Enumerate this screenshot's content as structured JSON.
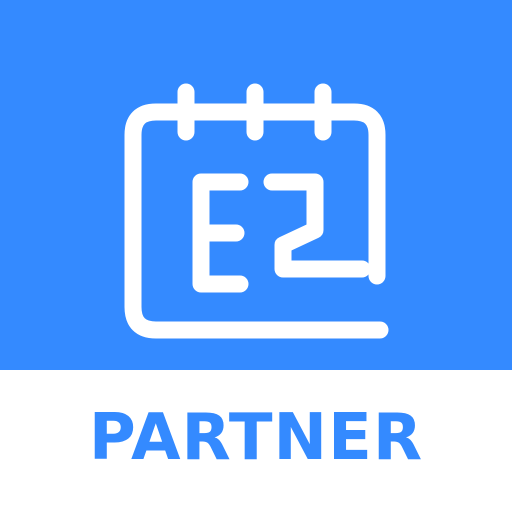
{
  "logo": {
    "icon": "calendar-icon",
    "monogram": "EZ"
  },
  "caption": {
    "text": "PARTNER"
  },
  "colors": {
    "brand_blue": "#348AFF",
    "foreground": "#FFFFFF",
    "background": "#FFFFFF"
  }
}
